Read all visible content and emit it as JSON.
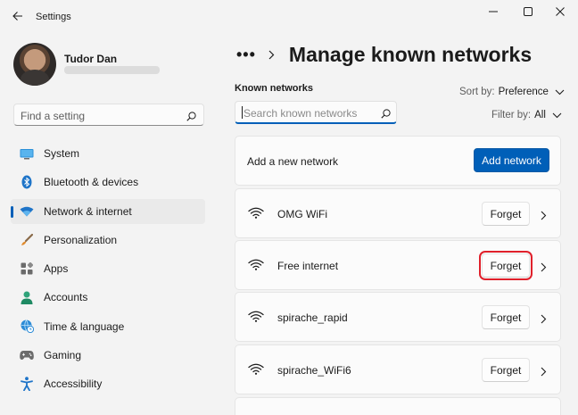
{
  "window": {
    "title": "Settings",
    "controls": {
      "minimize": "minimize",
      "maximize": "maximize",
      "close": "close"
    }
  },
  "user": {
    "name": "Tudor Dan"
  },
  "sidebar": {
    "search_placeholder": "Find a setting",
    "items": [
      {
        "label": "System",
        "icon": "monitor-icon",
        "active": false
      },
      {
        "label": "Bluetooth & devices",
        "icon": "bluetooth-icon",
        "active": false
      },
      {
        "label": "Network & internet",
        "icon": "wifi-diamond-icon",
        "active": true
      },
      {
        "label": "Personalization",
        "icon": "brush-icon",
        "active": false
      },
      {
        "label": "Apps",
        "icon": "apps-icon",
        "active": false
      },
      {
        "label": "Accounts",
        "icon": "person-icon",
        "active": false
      },
      {
        "label": "Time & language",
        "icon": "globe-clock-icon",
        "active": false
      },
      {
        "label": "Gaming",
        "icon": "gamepad-icon",
        "active": false
      },
      {
        "label": "Accessibility",
        "icon": "accessibility-icon",
        "active": false
      }
    ]
  },
  "main": {
    "breadcrumb_overflow": "•••",
    "page_title": "Manage known networks",
    "section_label": "Known networks",
    "search_placeholder": "Search known networks",
    "sort_label": "Sort by:",
    "sort_value": "Preference",
    "filter_label": "Filter by:",
    "filter_value": "All",
    "add_row_label": "Add a new network",
    "add_button_label": "Add network",
    "networks": [
      {
        "name": "OMG WiFi",
        "forget_label": "Forget",
        "highlighted": false
      },
      {
        "name": "Free internet",
        "forget_label": "Forget",
        "highlighted": true
      },
      {
        "name": "spirache_rapid",
        "forget_label": "Forget",
        "highlighted": false
      },
      {
        "name": "spirache_WiFi6",
        "forget_label": "Forget",
        "highlighted": false
      }
    ]
  },
  "colors": {
    "accent": "#005fb8",
    "highlight": "#e0202b",
    "background": "#f3f3f3",
    "card": "#fbfbfb"
  }
}
